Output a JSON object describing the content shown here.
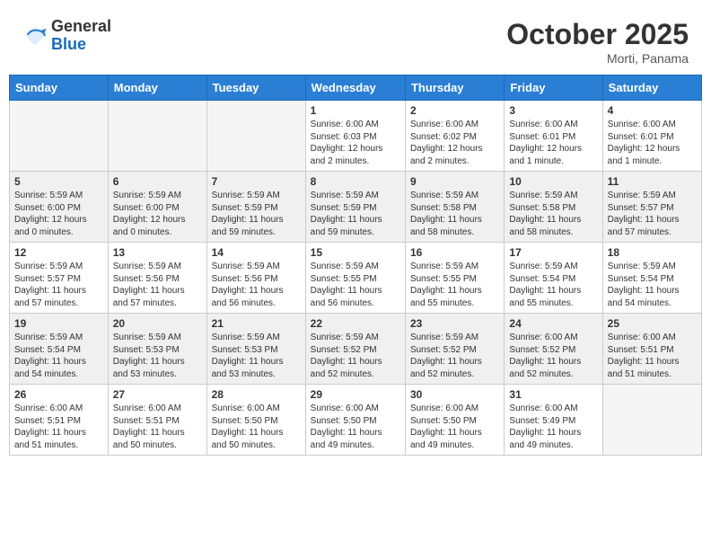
{
  "header": {
    "logo_general": "General",
    "logo_blue": "Blue",
    "month": "October 2025",
    "location": "Morti, Panama"
  },
  "weekdays": [
    "Sunday",
    "Monday",
    "Tuesday",
    "Wednesday",
    "Thursday",
    "Friday",
    "Saturday"
  ],
  "weeks": [
    [
      {
        "day": "",
        "info": ""
      },
      {
        "day": "",
        "info": ""
      },
      {
        "day": "",
        "info": ""
      },
      {
        "day": "1",
        "info": "Sunrise: 6:00 AM\nSunset: 6:03 PM\nDaylight: 12 hours\nand 2 minutes."
      },
      {
        "day": "2",
        "info": "Sunrise: 6:00 AM\nSunset: 6:02 PM\nDaylight: 12 hours\nand 2 minutes."
      },
      {
        "day": "3",
        "info": "Sunrise: 6:00 AM\nSunset: 6:01 PM\nDaylight: 12 hours\nand 1 minute."
      },
      {
        "day": "4",
        "info": "Sunrise: 6:00 AM\nSunset: 6:01 PM\nDaylight: 12 hours\nand 1 minute."
      }
    ],
    [
      {
        "day": "5",
        "info": "Sunrise: 5:59 AM\nSunset: 6:00 PM\nDaylight: 12 hours\nand 0 minutes."
      },
      {
        "day": "6",
        "info": "Sunrise: 5:59 AM\nSunset: 6:00 PM\nDaylight: 12 hours\nand 0 minutes."
      },
      {
        "day": "7",
        "info": "Sunrise: 5:59 AM\nSunset: 5:59 PM\nDaylight: 11 hours\nand 59 minutes."
      },
      {
        "day": "8",
        "info": "Sunrise: 5:59 AM\nSunset: 5:59 PM\nDaylight: 11 hours\nand 59 minutes."
      },
      {
        "day": "9",
        "info": "Sunrise: 5:59 AM\nSunset: 5:58 PM\nDaylight: 11 hours\nand 58 minutes."
      },
      {
        "day": "10",
        "info": "Sunrise: 5:59 AM\nSunset: 5:58 PM\nDaylight: 11 hours\nand 58 minutes."
      },
      {
        "day": "11",
        "info": "Sunrise: 5:59 AM\nSunset: 5:57 PM\nDaylight: 11 hours\nand 57 minutes."
      }
    ],
    [
      {
        "day": "12",
        "info": "Sunrise: 5:59 AM\nSunset: 5:57 PM\nDaylight: 11 hours\nand 57 minutes."
      },
      {
        "day": "13",
        "info": "Sunrise: 5:59 AM\nSunset: 5:56 PM\nDaylight: 11 hours\nand 57 minutes."
      },
      {
        "day": "14",
        "info": "Sunrise: 5:59 AM\nSunset: 5:56 PM\nDaylight: 11 hours\nand 56 minutes."
      },
      {
        "day": "15",
        "info": "Sunrise: 5:59 AM\nSunset: 5:55 PM\nDaylight: 11 hours\nand 56 minutes."
      },
      {
        "day": "16",
        "info": "Sunrise: 5:59 AM\nSunset: 5:55 PM\nDaylight: 11 hours\nand 55 minutes."
      },
      {
        "day": "17",
        "info": "Sunrise: 5:59 AM\nSunset: 5:54 PM\nDaylight: 11 hours\nand 55 minutes."
      },
      {
        "day": "18",
        "info": "Sunrise: 5:59 AM\nSunset: 5:54 PM\nDaylight: 11 hours\nand 54 minutes."
      }
    ],
    [
      {
        "day": "19",
        "info": "Sunrise: 5:59 AM\nSunset: 5:54 PM\nDaylight: 11 hours\nand 54 minutes."
      },
      {
        "day": "20",
        "info": "Sunrise: 5:59 AM\nSunset: 5:53 PM\nDaylight: 11 hours\nand 53 minutes."
      },
      {
        "day": "21",
        "info": "Sunrise: 5:59 AM\nSunset: 5:53 PM\nDaylight: 11 hours\nand 53 minutes."
      },
      {
        "day": "22",
        "info": "Sunrise: 5:59 AM\nSunset: 5:52 PM\nDaylight: 11 hours\nand 52 minutes."
      },
      {
        "day": "23",
        "info": "Sunrise: 5:59 AM\nSunset: 5:52 PM\nDaylight: 11 hours\nand 52 minutes."
      },
      {
        "day": "24",
        "info": "Sunrise: 6:00 AM\nSunset: 5:52 PM\nDaylight: 11 hours\nand 52 minutes."
      },
      {
        "day": "25",
        "info": "Sunrise: 6:00 AM\nSunset: 5:51 PM\nDaylight: 11 hours\nand 51 minutes."
      }
    ],
    [
      {
        "day": "26",
        "info": "Sunrise: 6:00 AM\nSunset: 5:51 PM\nDaylight: 11 hours\nand 51 minutes."
      },
      {
        "day": "27",
        "info": "Sunrise: 6:00 AM\nSunset: 5:51 PM\nDaylight: 11 hours\nand 50 minutes."
      },
      {
        "day": "28",
        "info": "Sunrise: 6:00 AM\nSunset: 5:50 PM\nDaylight: 11 hours\nand 50 minutes."
      },
      {
        "day": "29",
        "info": "Sunrise: 6:00 AM\nSunset: 5:50 PM\nDaylight: 11 hours\nand 49 minutes."
      },
      {
        "day": "30",
        "info": "Sunrise: 6:00 AM\nSunset: 5:50 PM\nDaylight: 11 hours\nand 49 minutes."
      },
      {
        "day": "31",
        "info": "Sunrise: 6:00 AM\nSunset: 5:49 PM\nDaylight: 11 hours\nand 49 minutes."
      },
      {
        "day": "",
        "info": ""
      }
    ]
  ]
}
